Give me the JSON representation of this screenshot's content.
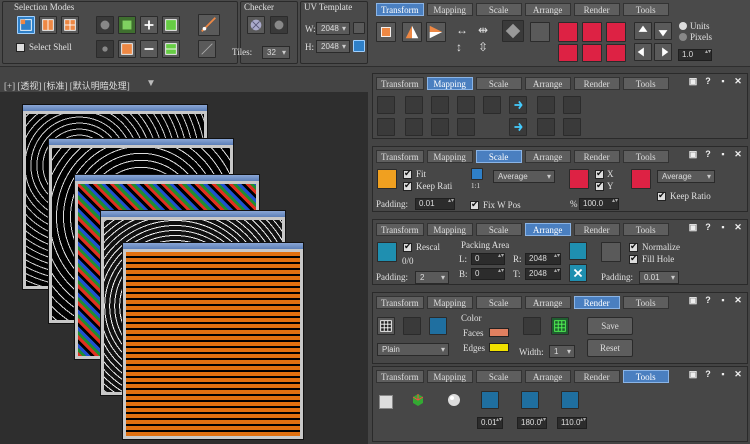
{
  "toolbar": {
    "selection_modes": {
      "title": "Selection Modes",
      "select_shell": "Select Shell"
    },
    "checker": {
      "title": "Checker",
      "tiles_label": "Tiles:",
      "tiles_value": "32"
    },
    "uv_template": {
      "title": "UV Template",
      "w_label": "W:",
      "w_value": "2048",
      "h_label": "H:",
      "h_value": "2048"
    },
    "units": {
      "units_label": "Units",
      "pixels_label": "Pixels",
      "scale_value": "1.0"
    },
    "tabs": [
      "Transform",
      "Mapping",
      "Scale",
      "Arrange",
      "Render",
      "Tools"
    ]
  },
  "viewport": {
    "label": "[+] [透视] [标准] [默认明暗处理]",
    "filter_icon": "funnel-icon"
  },
  "panels": {
    "tabs": [
      "Transform",
      "Mapping",
      "Scale",
      "Arrange",
      "Render",
      "Tools"
    ],
    "header_icons": [
      "▣",
      "?",
      "▪",
      "✕"
    ],
    "scale": {
      "fit": "Fit",
      "keep_ratio_left": "Keep Rati",
      "padding_label": "Padding:",
      "padding_value": "0.01",
      "average_1": "Average",
      "fix_w_pos": "Fix W Pos",
      "percent_label": "%",
      "percent_value": "100.0",
      "x_label": "X",
      "y_label": "Y",
      "average_2": "Average",
      "keep_ratio": "Keep Ratio",
      "ratio_label": "1:1"
    },
    "arrange": {
      "rescal": "Rescal",
      "zero_zero": "0/0",
      "padding_label": "Padding:",
      "padding_value": "2",
      "packing_area": "Packing Area",
      "l_label": "L:",
      "l_value": "0",
      "r_label": "R:",
      "r_value": "2048",
      "b_label": "B:",
      "b_value": "0",
      "t_label": "T:",
      "t_value": "2048",
      "normalize": "Normalize",
      "fill_hole": "Fill Hole",
      "padding2_label": "Padding:",
      "padding2_value": "0.01"
    },
    "render": {
      "color_label": "Color",
      "faces_label": "Faces",
      "edges_label": "Edges",
      "faces_color": "#e08060",
      "edges_color": "#f0e000",
      "mode_value": "Plain",
      "width_label": "Width:",
      "width_value": "1",
      "save": "Save",
      "reset": "Reset"
    },
    "tools": {
      "v1": "0.01",
      "v2": "180.0",
      "v3": "110.0"
    }
  }
}
